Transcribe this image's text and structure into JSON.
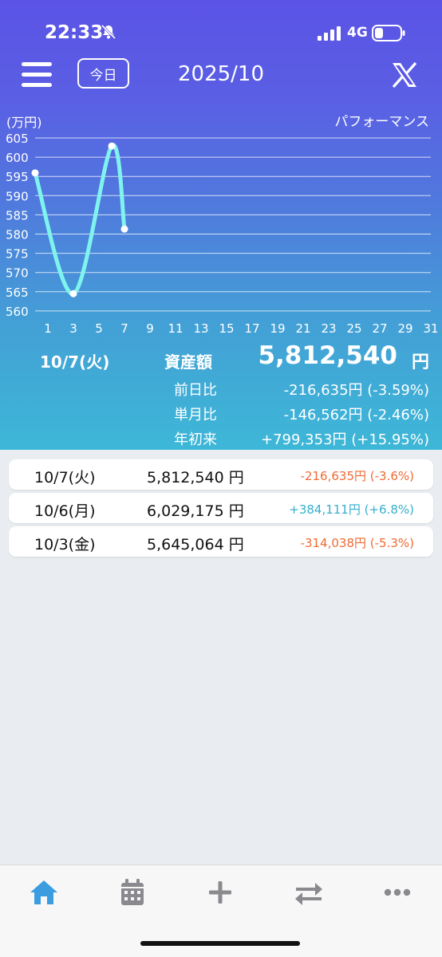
{
  "status": {
    "time": "22:33",
    "network": "4G"
  },
  "header": {
    "today_label": "今日",
    "month_title": "2025/10"
  },
  "chart_labels": {
    "unit": "(万円)",
    "performance": "パフォーマンス"
  },
  "chart_data": {
    "type": "line",
    "xlabel": "",
    "ylabel": "(万円)",
    "y_ticks": [
      605,
      600,
      595,
      590,
      585,
      580,
      575,
      570,
      565,
      560
    ],
    "x_ticks": [
      1,
      3,
      5,
      7,
      9,
      11,
      13,
      15,
      17,
      19,
      21,
      23,
      25,
      27,
      29,
      31
    ],
    "xlim": [
      0,
      31
    ],
    "ylim": [
      558,
      607
    ],
    "grid": true,
    "series": [
      {
        "x": [
          0,
          3,
          6,
          7
        ],
        "y": [
          595.9,
          564.5,
          602.9,
          581.3
        ]
      }
    ],
    "colors": {
      "line": "#7ff4ee",
      "grid": "#ffffff"
    }
  },
  "summary": {
    "date": "10/7(火)",
    "asset_label": "資産額",
    "asset_value": "5,812,540",
    "yen": "円",
    "rows": [
      {
        "label": "前日比",
        "value": "-216,635円 (-3.59%)"
      },
      {
        "label": "単月比",
        "value": "-146,562円 (-2.46%)"
      },
      {
        "label": "年初来",
        "value": "+799,353円 (+15.95%)"
      }
    ]
  },
  "history": [
    {
      "date": "10/7(火)",
      "value": "5,812,540 円",
      "change": "-216,635円 (-3.6%)",
      "trend": "neg"
    },
    {
      "date": "10/6(月)",
      "value": "6,029,175 円",
      "change": "+384,111円 (+6.8%)",
      "trend": "pos"
    },
    {
      "date": "10/3(金)",
      "value": "5,645,064 円",
      "change": "-314,038円 (-5.3%)",
      "trend": "neg"
    }
  ],
  "tabbar": {
    "icons": [
      "home-icon",
      "calendar-icon",
      "plus-icon",
      "transfer-icon",
      "more-icon"
    ],
    "active_color": "#3b9de0",
    "inactive_color": "#8a8a8e"
  }
}
